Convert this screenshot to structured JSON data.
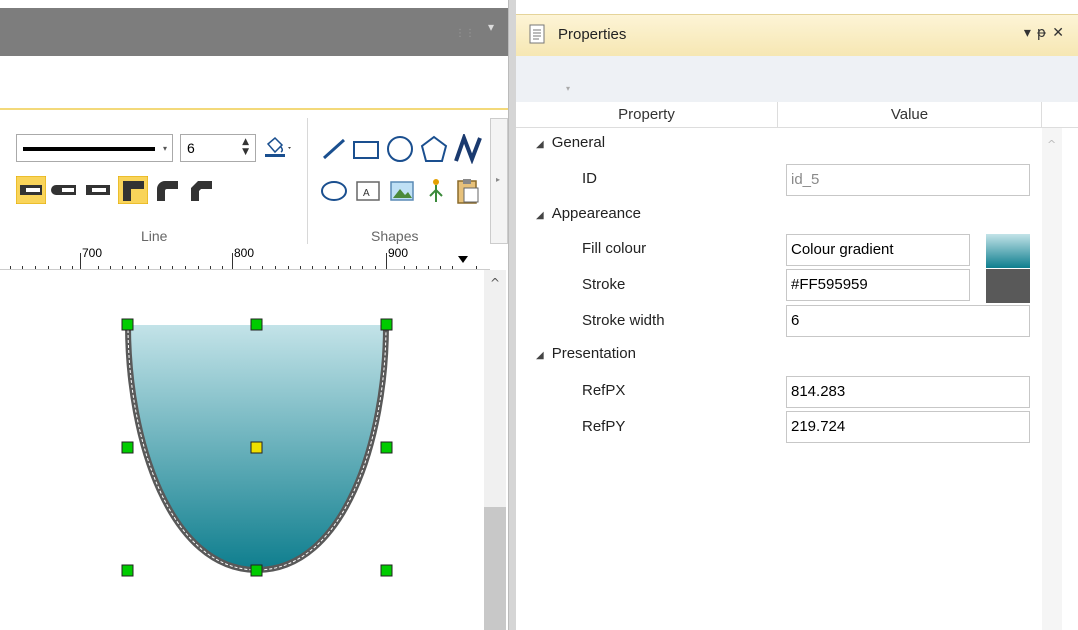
{
  "ribbon": {
    "line_group_label": "Line",
    "shapes_group_label": "Shapes",
    "line_width_value": "6"
  },
  "ruler": {
    "labels": [
      "700",
      "800",
      "900"
    ]
  },
  "properties_panel": {
    "title": "Properties",
    "header_property": "Property",
    "header_value": "Value",
    "categories": {
      "general": "General",
      "appearance": "Appeareance",
      "presentation": "Presentation"
    },
    "rows": {
      "id_label": "ID",
      "id_value": "id_5",
      "fill_label": "Fill colour",
      "fill_value": "Colour gradient",
      "stroke_label": "Stroke",
      "stroke_value": "#FF595959",
      "stroke_width_label": "Stroke width",
      "stroke_width_value": "6",
      "refpx_label": "RefPX",
      "refpx_value": "814.283",
      "refpy_label": "RefPY",
      "refpy_value": "219.724"
    }
  },
  "colors": {
    "fill_gradient_top": "#c3e3e8",
    "fill_gradient_bottom": "#0e7e8e",
    "stroke_color": "#595959",
    "handle_green": "#00cc00",
    "handle_yellow": "#f0e000",
    "accent_yellow": "#f3d97a"
  },
  "icons": {
    "line_style": "line-style-icon",
    "bucket": "paint-bucket-icon",
    "pin": "pin-icon",
    "close": "close-icon"
  }
}
